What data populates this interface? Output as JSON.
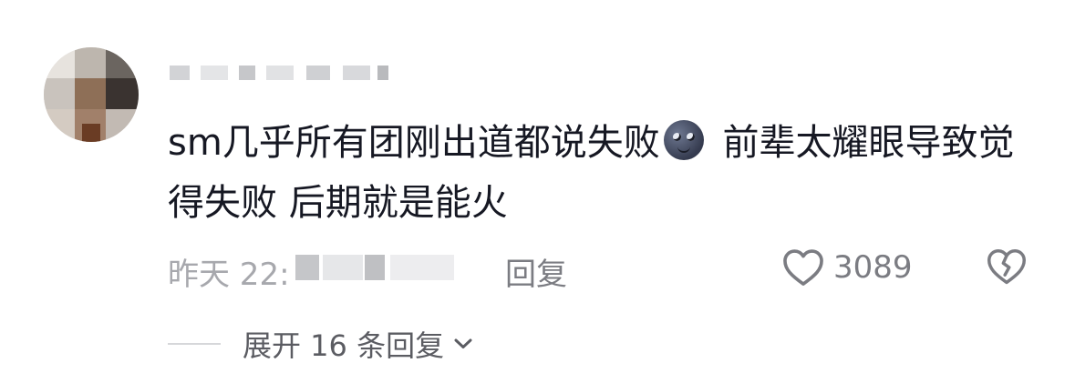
{
  "comment": {
    "text_part1": "sm几乎所有团刚出道都说失败",
    "emoji": "new-moon-face-emoji",
    "text_part2": " 前辈太耀眼导致觉得失败 后期就是能火"
  },
  "meta": {
    "time_prefix": "昨天 22:",
    "reply_label": "回复",
    "like_count": "3089"
  },
  "expand": {
    "label": "展开 16 条回复"
  },
  "icons": {
    "like": "heart-outline-icon",
    "dislike": "broken-heart-icon",
    "expand": "chevron-down-icon"
  }
}
